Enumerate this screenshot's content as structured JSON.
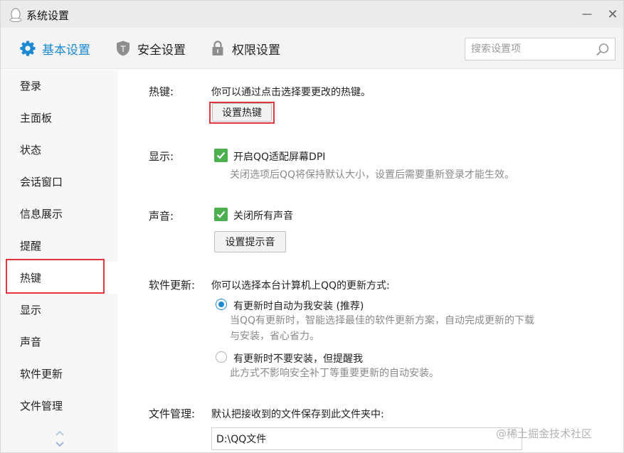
{
  "window": {
    "title": "系统设置",
    "minimize_glyph": "－",
    "close_glyph": "✕"
  },
  "topnav": {
    "tabs": [
      {
        "label": "基本设置",
        "icon": "gear-icon"
      },
      {
        "label": "安全设置",
        "icon": "shield-icon"
      },
      {
        "label": "权限设置",
        "icon": "lock-icon"
      }
    ],
    "search": {
      "placeholder": "搜索设置项"
    }
  },
  "sidebar": {
    "items": [
      {
        "label": "登录"
      },
      {
        "label": "主面板"
      },
      {
        "label": "状态"
      },
      {
        "label": "会话窗口"
      },
      {
        "label": "信息展示"
      },
      {
        "label": "提醒"
      },
      {
        "label": "热键"
      },
      {
        "label": "显示"
      },
      {
        "label": "声音"
      },
      {
        "label": "软件更新"
      },
      {
        "label": "文件管理"
      }
    ],
    "active": "热键"
  },
  "hotkey": {
    "label": "热键:",
    "description": "你可以通过点击选择要更改的热键。",
    "button": "设置热键"
  },
  "display": {
    "label": "显示:",
    "checkbox_label": "开启QQ适配屏幕DPI",
    "checked": true,
    "hint": "关闭选项后QQ将保持默认大小，设置后需要重新登录才能生效。"
  },
  "sound": {
    "label": "声音:",
    "checkbox_label": "关闭所有声音",
    "checked": true,
    "button": "设置提示音"
  },
  "update": {
    "label": "软件更新:",
    "description": "你可以选择本台计算机上QQ的更新方式:",
    "options": [
      {
        "label": "有更新时自动为我安装 (推荐)",
        "hint_line1": "当QQ有更新时，智能选择最佳的软件更新方案，自动完成更新的下载",
        "hint_line2": "与安装，省心省力。",
        "selected": true
      },
      {
        "label": "有更新时不要安装，但提醒我",
        "hint_line1": "此方式不影响安全补丁等重要更新的自动安装。",
        "selected": false
      }
    ]
  },
  "files": {
    "label": "文件管理:",
    "description": "默认把接收到的文件保存到此文件夹中:",
    "path": "D:\\QQ文件"
  },
  "watermark": "@稀土掘金技术社区",
  "colors": {
    "accent": "#1b8ad3",
    "check": "#4caf50",
    "highlight": "#e2343a"
  }
}
